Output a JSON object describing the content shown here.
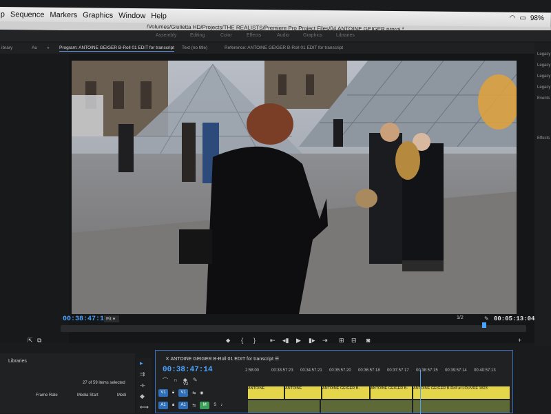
{
  "menubar": {
    "items": [
      "lip",
      "Sequence",
      "Markers",
      "Graphics",
      "Window",
      "Help"
    ],
    "battery": "98%"
  },
  "window": {
    "title": "/Volumes/Giulietta HD/Projects/THE REALISTS/Premiere Pro Project Files/04 ANTOINE GEIGER.prproj *"
  },
  "workspaces": [
    "Assembly",
    "Editing",
    "Color",
    "Effects",
    "Audio",
    "Graphics",
    "Libraries"
  ],
  "panel_tabs": {
    "left_a": "ibrary",
    "left_b": "Au",
    "program": "Program: ANTOINE GEIGER B-Roll 01 EDIT for transcript",
    "text": "Text (no title)",
    "reference": "Reference: ANTOINE GEIGER B-Roll 01 EDIT for transcript"
  },
  "right_panel": [
    "Legacy",
    "Legacy",
    "Legacy",
    "Legacy",
    "Events",
    "Effects"
  ],
  "monitor": {
    "current_tc": "00:38:47:14",
    "fit": "Fit",
    "resolution": "1/2",
    "duration_tc": "00:05:13:04"
  },
  "libraries": {
    "title": "Libraries",
    "selection": "27 of 59 items selected",
    "columns": [
      "Frame Rate",
      "Media Start",
      "Medi"
    ]
  },
  "timeline": {
    "title": "ANTOINE GEIGER B-Roll 01 EDIT for transcript",
    "tc": "00:38:47:14",
    "ruler": [
      "2:58:00",
      "00:33:57:23",
      "00:34:57:21",
      "00:35:57:20",
      "00:36:57:18",
      "00:37:57:17",
      "00:38:57:15",
      "00:39:57:14",
      "00:40:57:13"
    ],
    "tracks": {
      "v1a": "V1",
      "v1b": "V1",
      "a1a": "A1",
      "a1b": "A1",
      "v2": "V2",
      "m": "M",
      "s": "S"
    },
    "clips": [
      "ANTOINE",
      "ANTOINE",
      "ANTOINE GEIGER B-",
      "ANTOINE GEIGER B-",
      "ANTOINE GEIGER B-Roll at LOUVRE 1823"
    ]
  }
}
